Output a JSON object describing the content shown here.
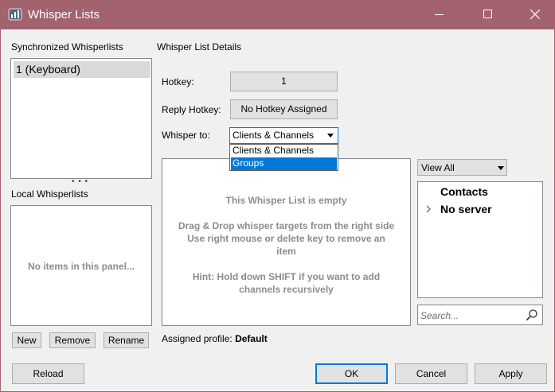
{
  "window": {
    "title": "Whisper Lists",
    "app_icon": "teamspeak-icon",
    "controls": {
      "minimize_icon": "minimize-icon",
      "maximize_icon": "maximize-icon",
      "close_icon": "close-icon"
    }
  },
  "left": {
    "sync_heading": "Synchronized Whisperlists",
    "sync_items": [
      "1 (Keyboard)"
    ],
    "splitter": "• • •",
    "local_heading": "Local Whisperlists",
    "local_empty": "No items in this panel...",
    "buttons": {
      "new": "New",
      "remove": "Remove",
      "rename": "Rename"
    }
  },
  "details": {
    "heading": "Whisper List Details",
    "hotkey_label": "Hotkey:",
    "hotkey_value": "1",
    "reply_hotkey_label": "Reply Hotkey:",
    "reply_hotkey_value": "No Hotkey Assigned",
    "whisper_to_label": "Whisper to:",
    "whisper_to_value": "Clients & Channels",
    "whisper_to_options": [
      "Clients & Channels",
      "Groups"
    ],
    "whisper_to_highlighted": "Groups",
    "empty_title": "This Whisper List is empty",
    "empty_drag_line1": "Drag & Drop whisper targets from the right side",
    "empty_drag_line2": "Use right mouse or delete key to remove an",
    "empty_drag_line3": "item",
    "empty_hint_line1": "Hint: Hold down SHIFT if you want to add",
    "empty_hint_line2": "channels recursively",
    "assigned_profile_label": "Assigned profile:",
    "assigned_profile_value": "Default"
  },
  "targets": {
    "view_filter": "View All",
    "tree": [
      {
        "label": "Contacts",
        "expandable": false
      },
      {
        "label": "No server",
        "expandable": true
      }
    ],
    "search_placeholder": "Search...",
    "search_icon": "search-icon"
  },
  "footer": {
    "reload": "Reload",
    "ok": "OK",
    "cancel": "Cancel",
    "apply": "Apply"
  },
  "colors": {
    "titlebar": "#a2636e",
    "selection": "#0078d7",
    "muted_text": "#8c8c8c"
  }
}
